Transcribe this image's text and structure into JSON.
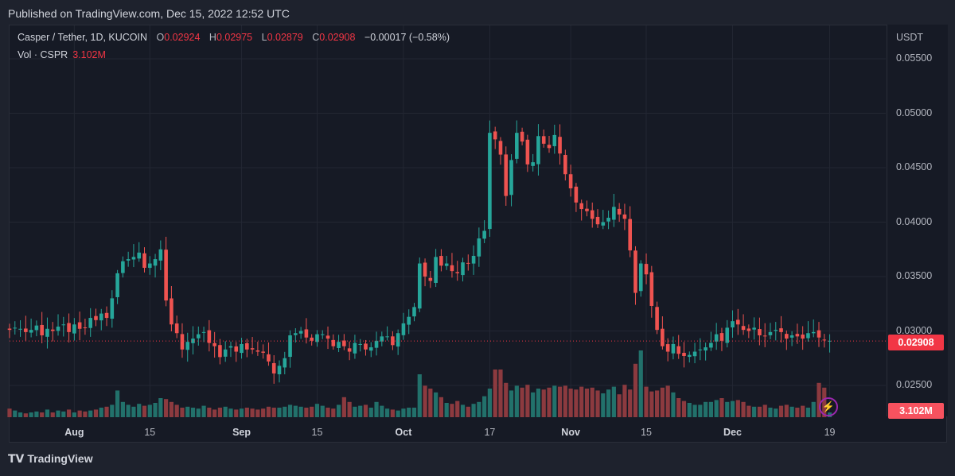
{
  "header": {
    "published": "Published on TradingView.com, Dec 15, 2022 12:52 UTC"
  },
  "legend": {
    "symbol": "Casper / Tether, 1D, KUCOIN",
    "o_label": "O",
    "o": "0.02924",
    "h_label": "H",
    "h": "0.02975",
    "l_label": "L",
    "l": "0.02879",
    "c_label": "C",
    "c": "0.02908",
    "change": "−0.00017 (−0.58%)",
    "vol_label": "Vol · CSPR",
    "vol_value": "3.102M"
  },
  "axis": {
    "unit": "USDT",
    "price_tag": "0.02908",
    "volume_tag": "3.102M"
  },
  "footer": {
    "brand": "TradingView",
    "logo": "TV"
  },
  "colors": {
    "up": "#26a69a",
    "down": "#ef5350",
    "up_vol": "#22716b",
    "down_vol": "#8c3a3f",
    "last": "#f23645"
  },
  "chart_data": {
    "type": "candlestick",
    "title": "Casper / Tether, 1D, KUCOIN",
    "ylabel": "USDT",
    "ylim": [
      0.0235,
      0.056
    ],
    "y_ticks": [
      "0.02500",
      "0.03000",
      "0.03500",
      "0.04000",
      "0.04500",
      "0.05000",
      "0.05500"
    ],
    "x_ticks": [
      {
        "label": "Aug",
        "day": 12,
        "bold": true
      },
      {
        "label": "15",
        "day": 26,
        "bold": false
      },
      {
        "label": "Sep",
        "day": 43,
        "bold": true
      },
      {
        "label": "15",
        "day": 57,
        "bold": false
      },
      {
        "label": "Oct",
        "day": 73,
        "bold": true
      },
      {
        "label": "17",
        "day": 89,
        "bold": false
      },
      {
        "label": "Nov",
        "day": 104,
        "bold": true
      },
      {
        "label": "15",
        "day": 118,
        "bold": false
      },
      {
        "label": "Dec",
        "day": 134,
        "bold": true
      },
      {
        "label": "19",
        "day": 152,
        "bold": false
      }
    ],
    "last_close": 0.02908,
    "closes": [
      0.0301,
      0.0303,
      0.0302,
      0.0299,
      0.0301,
      0.0305,
      0.0296,
      0.0302,
      0.03,
      0.0304,
      0.0306,
      0.0299,
      0.0306,
      0.0302,
      0.0303,
      0.0312,
      0.031,
      0.0316,
      0.0312,
      0.033,
      0.0353,
      0.0364,
      0.0366,
      0.0368,
      0.0372,
      0.0358,
      0.0362,
      0.0366,
      0.0375,
      0.0328,
      0.0306,
      0.0298,
      0.0283,
      0.029,
      0.0293,
      0.0297,
      0.0299,
      0.0289,
      0.0286,
      0.0276,
      0.0283,
      0.0286,
      0.0281,
      0.0288,
      0.0283,
      0.0283,
      0.0281,
      0.028,
      0.0272,
      0.0261,
      0.0268,
      0.0275,
      0.0296,
      0.0298,
      0.03,
      0.0294,
      0.0291,
      0.0297,
      0.0297,
      0.0293,
      0.0286,
      0.029,
      0.0286,
      0.0281,
      0.0289,
      0.0288,
      0.0283,
      0.0285,
      0.0291,
      0.0295,
      0.0295,
      0.0287,
      0.0298,
      0.0307,
      0.0313,
      0.0322,
      0.0362,
      0.035,
      0.0346,
      0.0368,
      0.036,
      0.0362,
      0.0355,
      0.0353,
      0.0363,
      0.0362,
      0.0369,
      0.0385,
      0.0392,
      0.0482,
      0.0476,
      0.0462,
      0.0424,
      0.0457,
      0.0482,
      0.0474,
      0.0453,
      0.0455,
      0.0479,
      0.0472,
      0.0468,
      0.048,
      0.0463,
      0.0444,
      0.0431,
      0.0418,
      0.0412,
      0.041,
      0.0403,
      0.0398,
      0.04,
      0.0404,
      0.0414,
      0.0407,
      0.0403,
      0.0374,
      0.0335,
      0.0362,
      0.0352,
      0.0323,
      0.0301,
      0.0286,
      0.0281,
      0.0288,
      0.0279,
      0.0277,
      0.0278,
      0.0281,
      0.0283,
      0.0285,
      0.0289,
      0.0297,
      0.0291,
      0.0303,
      0.0309,
      0.0306,
      0.0301,
      0.03,
      0.0303,
      0.0296,
      0.0295,
      0.0299,
      0.0301,
      0.0299,
      0.0293,
      0.0296,
      0.0295,
      0.0293,
      0.0298,
      0.0299,
      0.0294,
      0.0292,
      0.0291
    ],
    "volumes_m": [
      0.9,
      0.7,
      0.5,
      0.4,
      0.5,
      0.6,
      0.5,
      0.8,
      0.5,
      0.7,
      0.6,
      0.8,
      0.5,
      0.7,
      0.6,
      0.7,
      0.8,
      1.0,
      1.1,
      1.3,
      2.8,
      1.6,
      1.3,
      1.1,
      1.4,
      1.2,
      1.3,
      1.5,
      2.0,
      1.9,
      1.6,
      1.3,
      1.0,
      1.1,
      1.0,
      0.9,
      1.2,
      1.0,
      0.8,
      1.0,
      1.1,
      0.9,
      0.8,
      0.9,
      1.0,
      0.9,
      0.8,
      0.9,
      1.1,
      1.0,
      1.0,
      1.1,
      1.3,
      1.2,
      1.1,
      1.0,
      1.1,
      1.4,
      1.2,
      1.0,
      0.9,
      1.3,
      2.1,
      1.6,
      1.1,
      1.2,
      1.3,
      1.0,
      1.6,
      1.2,
      0.9,
      0.8,
      0.7,
      0.9,
      1.0,
      1.0,
      4.5,
      3.3,
      3.0,
      2.6,
      2.1,
      1.5,
      1.4,
      1.7,
      1.3,
      1.1,
      1.4,
      1.6,
      2.2,
      3.0,
      5.0,
      5.0,
      3.6,
      2.8,
      3.3,
      3.1,
      3.4,
      2.6,
      3.0,
      2.9,
      3.1,
      3.3,
      3.2,
      3.3,
      3.0,
      2.9,
      3.2,
      3.0,
      3.1,
      2.8,
      2.5,
      2.9,
      3.2,
      2.4,
      3.4,
      2.9,
      5.6,
      7.0,
      3.2,
      2.7,
      2.8,
      3.1,
      3.3,
      2.6,
      2.0,
      1.7,
      1.5,
      1.3,
      1.3,
      1.6,
      1.6,
      1.8,
      2.0,
      1.6,
      1.7,
      1.8,
      1.6,
      1.2,
      1.1,
      1.1,
      1.3,
      1.0,
      0.9,
      1.2,
      1.3,
      1.1,
      1.0,
      1.2,
      1.0,
      1.6,
      3.6,
      3.1
    ]
  }
}
